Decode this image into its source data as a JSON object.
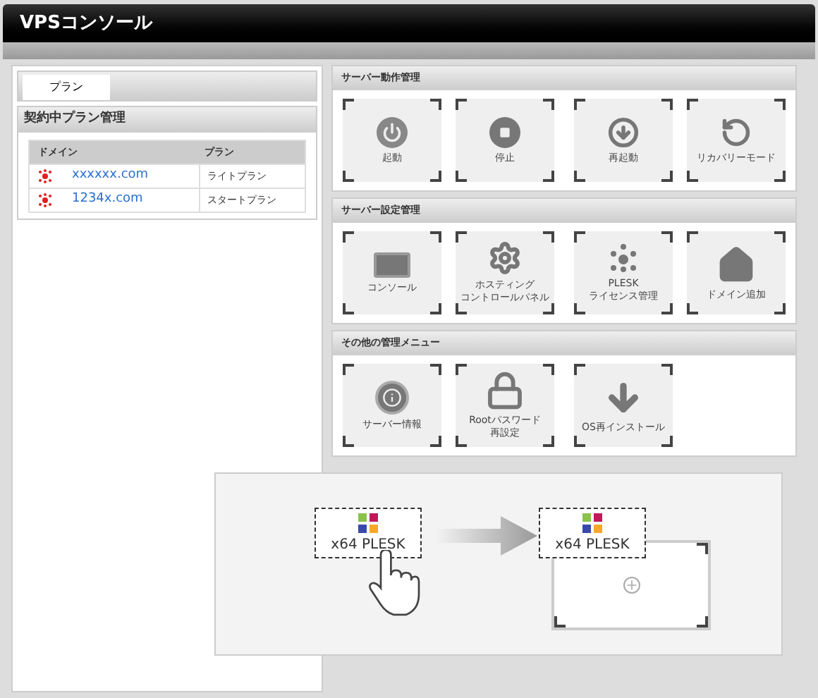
{
  "window": {
    "title": "VPSコンソール"
  },
  "left_panel": {
    "tabs": [
      {
        "label": "プラン",
        "selected": true
      }
    ],
    "section_title": "契約中プラン管理",
    "table": {
      "columns": [
        "ドメイン",
        "プラン"
      ],
      "rows": [
        {
          "domain": "xxxxxx.com",
          "plan": "ライトプラン"
        },
        {
          "domain": "1234x.com",
          "plan": "スタートプラン"
        }
      ]
    }
  },
  "sections": [
    {
      "title": "サーバー動作管理",
      "tiles": [
        {
          "kind": "power",
          "lines": [
            "起動"
          ]
        },
        {
          "kind": "stop",
          "lines": [
            "停止"
          ]
        },
        {
          "kind": "restart",
          "lines": [
            "再起動"
          ]
        },
        {
          "kind": "recovery",
          "lines": [
            "リカバリーモード"
          ]
        }
      ]
    },
    {
      "title": "サーバー設定管理",
      "tiles": [
        {
          "kind": "console",
          "lines": [
            "コンソール"
          ]
        },
        {
          "kind": "gear",
          "lines": [
            "ホスティング",
            "コントロールパネル"
          ]
        },
        {
          "kind": "dots",
          "lines": [
            "PLESK",
            "ライセンス管理"
          ]
        },
        {
          "kind": "home",
          "lines": [
            "ドメイン追加"
          ]
        }
      ]
    },
    {
      "title": "その他の管理メニュー",
      "tiles": [
        {
          "kind": "info",
          "lines": [
            "サーバー情報"
          ]
        },
        {
          "kind": "lock",
          "lines": [
            "Rootパスワード",
            "再設定"
          ]
        },
        {
          "kind": "download",
          "lines": [
            "OS再インストール"
          ]
        }
      ]
    }
  ],
  "overlay": {
    "source_label": "x64 PLESK",
    "target_label": "x64 PLESK"
  }
}
